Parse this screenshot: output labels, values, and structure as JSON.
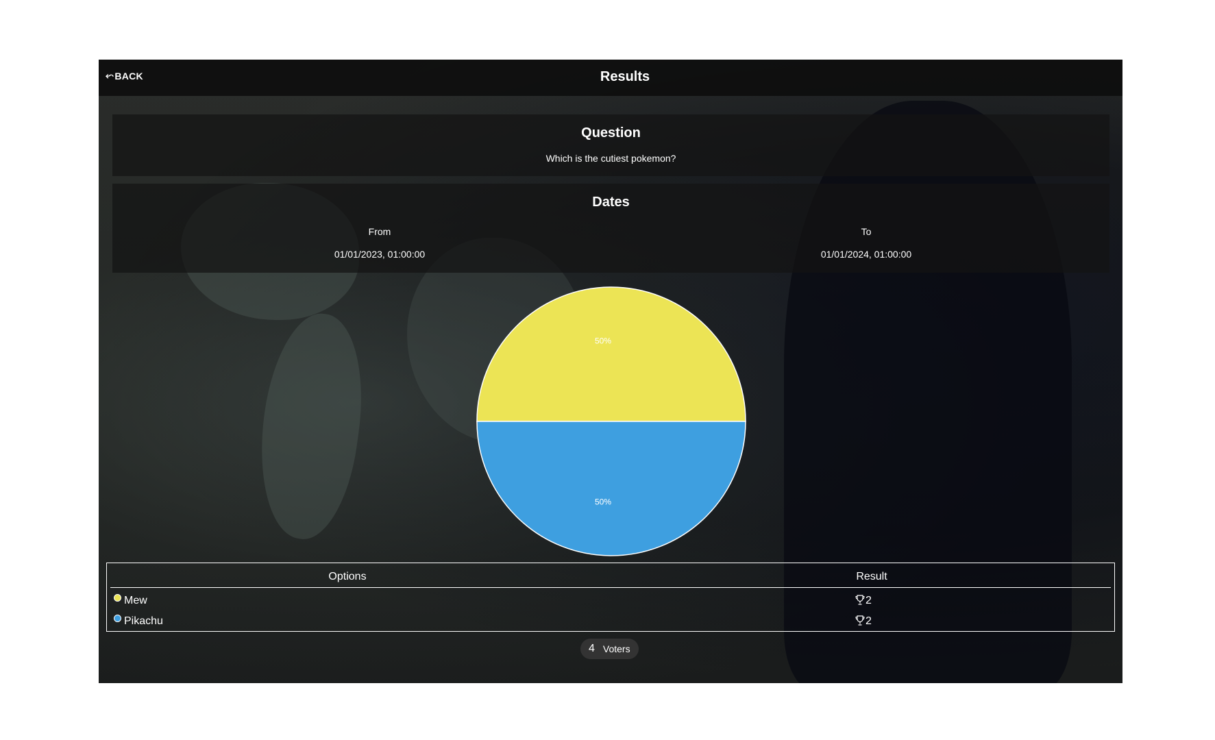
{
  "header": {
    "back_label": "BACK",
    "title": "Results"
  },
  "question": {
    "heading": "Question",
    "text": "Which is the cutiest pokemon?"
  },
  "dates": {
    "heading": "Dates",
    "from_label": "From",
    "from_value": "01/01/2023, 01:00:00",
    "to_label": "To",
    "to_value": "01/01/2024, 01:00:00"
  },
  "chart_data": {
    "type": "pie",
    "slices": [
      {
        "label": "Mew",
        "value": 50,
        "display": "50%",
        "color": "#ece455"
      },
      {
        "label": "Pikachu",
        "value": 50,
        "display": "50%",
        "color": "#3e9fe0"
      }
    ]
  },
  "table": {
    "headers": [
      "Options",
      "Result"
    ],
    "rows": [
      {
        "option": "Mew",
        "result": "2",
        "color": "#ece455"
      },
      {
        "option": "Pikachu",
        "result": "2",
        "color": "#3e9fe0"
      }
    ]
  },
  "voters": {
    "count": "4",
    "label": "Voters"
  },
  "icons": {
    "back": "back-arrow-icon",
    "result": "trophy-icon"
  }
}
